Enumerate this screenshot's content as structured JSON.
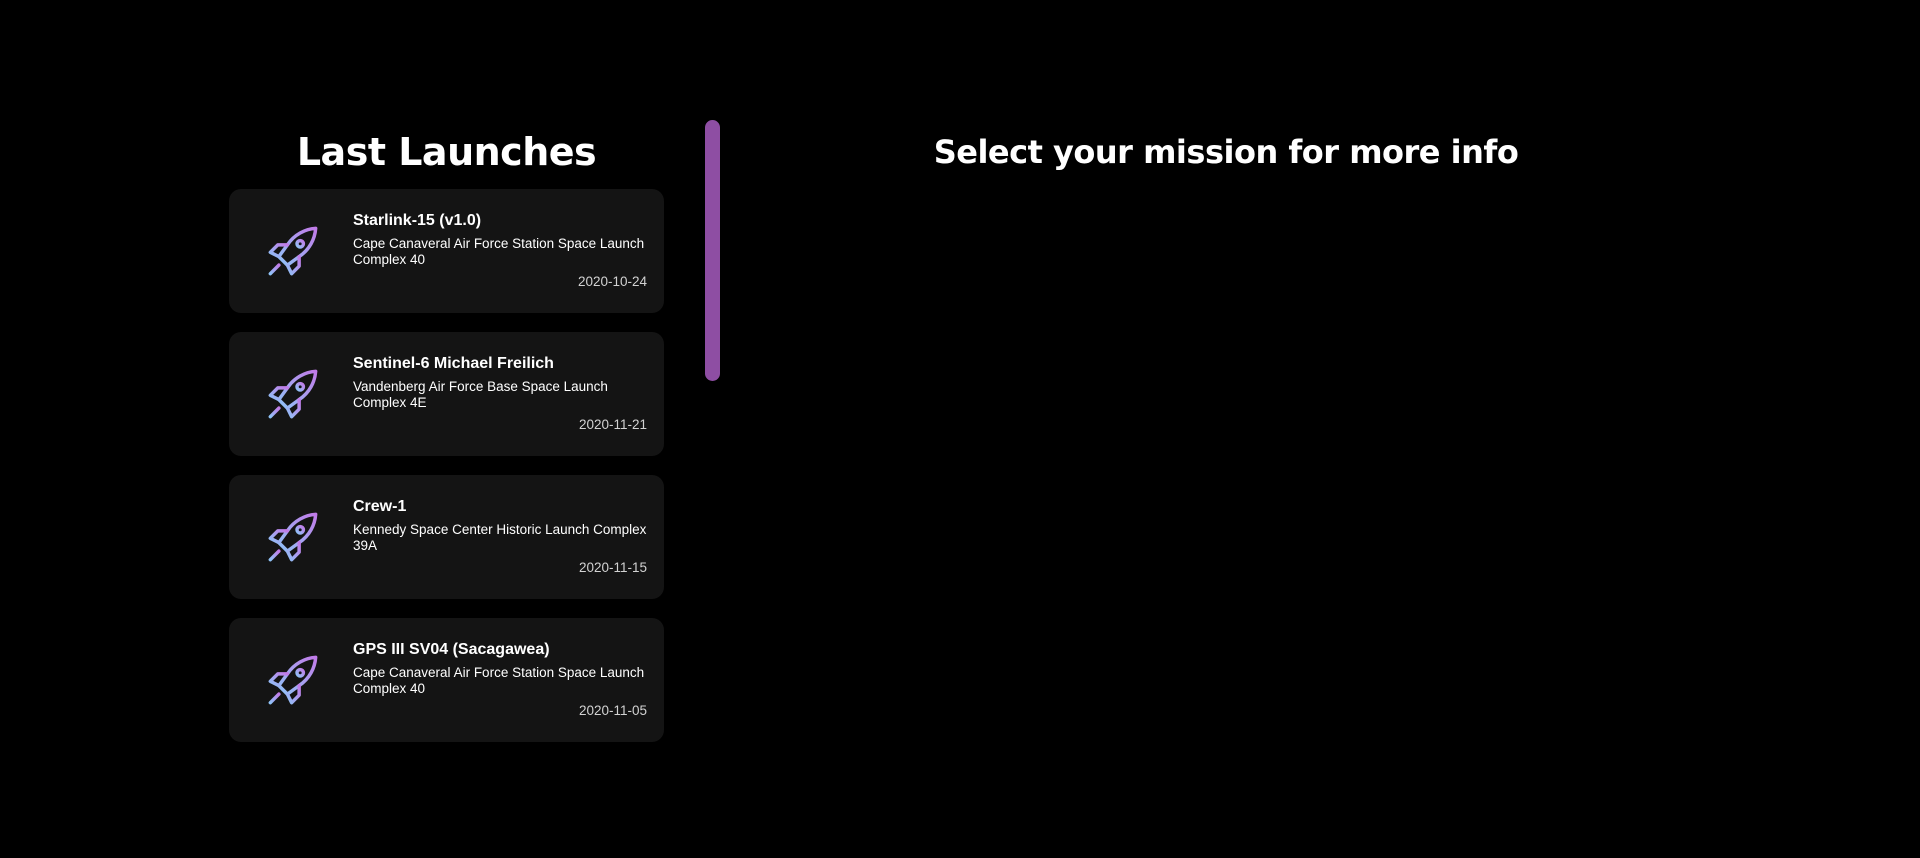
{
  "launches_panel": {
    "title": "Last Launches",
    "items": [
      {
        "icon": "rocket-icon",
        "mission_name": "Starlink-15 (v1.0)",
        "launch_site": "Cape Canaveral Air Force Station Space Launch Complex 40",
        "date": "2020-10-24"
      },
      {
        "icon": "rocket-icon",
        "mission_name": "Sentinel-6 Michael Freilich",
        "launch_site": "Vandenberg Air Force Base Space Launch Complex 4E",
        "date": "2020-11-21"
      },
      {
        "icon": "rocket-icon",
        "mission_name": "Crew-1",
        "launch_site": "Kennedy Space Center Historic Launch Complex 39A",
        "date": "2020-11-15"
      },
      {
        "icon": "rocket-icon",
        "mission_name": "GPS III SV04 (Sacagawea)",
        "launch_site": "Cape Canaveral Air Force Station Space Launch Complex 40",
        "date": "2020-11-05"
      }
    ]
  },
  "detail_panel": {
    "title": "Select your mission for more info"
  },
  "colors": {
    "background": "#000000",
    "card_background": "#141414",
    "scrollbar": "#8e4ea3",
    "icon_gradient_start": "#8fc3f7",
    "icon_gradient_end": "#c17be8"
  }
}
